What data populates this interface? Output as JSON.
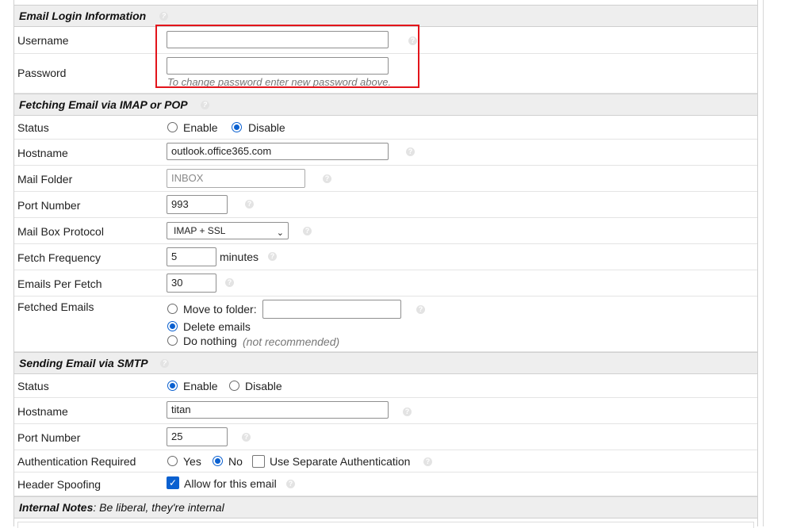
{
  "email_login": {
    "title": "Email Login Information",
    "username_label": "Username",
    "username_value": "",
    "password_label": "Password",
    "password_value": "",
    "password_hint": "To change password enter new password above."
  },
  "fetching": {
    "title": "Fetching Email via IMAP or POP",
    "status_label": "Status",
    "status_enable": "Enable",
    "status_disable": "Disable",
    "status_selected": "Disable",
    "hostname_label": "Hostname",
    "hostname_value": "outlook.office365.com",
    "mail_folder_label": "Mail Folder",
    "mail_folder_placeholder": "INBOX",
    "port_label": "Port Number",
    "port_value": "993",
    "protocol_label": "Mail Box Protocol",
    "protocol_value": "IMAP + SSL",
    "frequency_label": "Fetch Frequency",
    "frequency_value": "5",
    "frequency_unit": "minutes",
    "per_fetch_label": "Emails Per Fetch",
    "per_fetch_value": "30",
    "fetched_label": "Fetched Emails",
    "move_to_folder": "Move to folder:",
    "move_folder_value": "",
    "delete_emails": "Delete emails",
    "do_nothing": "Do nothing",
    "not_recommended": "(not recommended)",
    "fetched_selected": "Delete emails"
  },
  "sending": {
    "title": "Sending Email via SMTP",
    "status_label": "Status",
    "status_enable": "Enable",
    "status_disable": "Disable",
    "status_selected": "Enable",
    "hostname_label": "Hostname",
    "hostname_value": "titan",
    "port_label": "Port Number",
    "port_value": "25",
    "auth_label": "Authentication Required",
    "auth_yes": "Yes",
    "auth_no": "No",
    "auth_selected": "No",
    "separate_auth": "Use Separate Authentication",
    "separate_auth_checked": false,
    "spoofing_label": "Header Spoofing",
    "spoofing_option": "Allow for this email",
    "spoofing_checked": true
  },
  "notes": {
    "title": "Internal Notes",
    "subtitle": ": Be liberal, they're internal"
  },
  "colors": {
    "accent": "#0a60d0",
    "highlight": "#e3141b",
    "section_bg": "#eeeeee"
  },
  "icons": {
    "help": "question-circle-icon",
    "checkmark": "check-icon",
    "dropdown": "chevron-down-icon"
  }
}
